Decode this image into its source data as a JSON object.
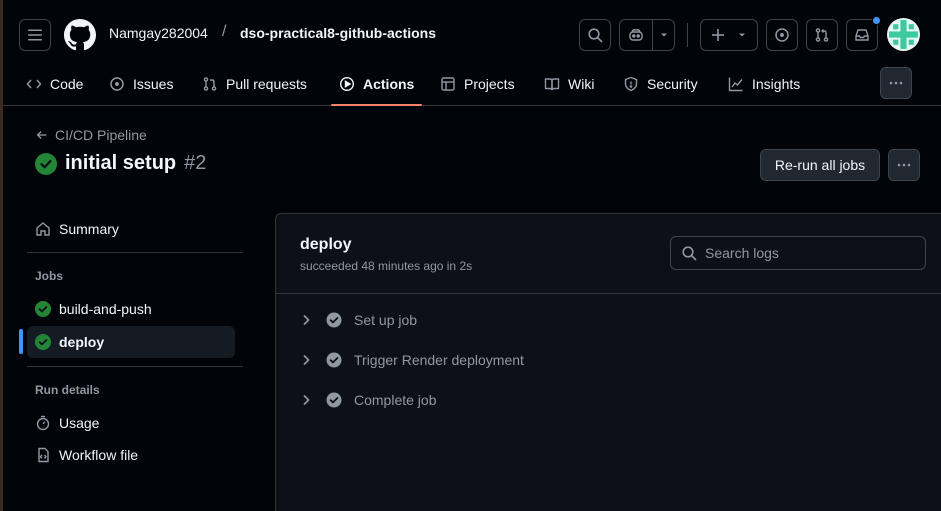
{
  "header": {
    "owner": "Namgay282004",
    "separator": "/",
    "repo": "dso-practical8-github-actions",
    "icons": [
      "menu-icon",
      "github-logo",
      "search-icon",
      "copilot-icon",
      "chevron-down-icon",
      "plus-icon",
      "issues-icon",
      "pull-request-icon",
      "inbox-icon",
      "avatar"
    ],
    "notification_dot_color": "#4493f8"
  },
  "nav": {
    "items": [
      {
        "label": "Code",
        "icon": "code-icon"
      },
      {
        "label": "Issues",
        "icon": "issue-icon"
      },
      {
        "label": "Pull requests",
        "icon": "pull-request-icon"
      },
      {
        "label": "Actions",
        "icon": "play-icon",
        "active": true
      },
      {
        "label": "Projects",
        "icon": "table-icon"
      },
      {
        "label": "Wiki",
        "icon": "book-icon"
      },
      {
        "label": "Security",
        "icon": "shield-icon"
      },
      {
        "label": "Insights",
        "icon": "graph-icon"
      }
    ],
    "active_underline_color": "#f78166"
  },
  "run": {
    "back_label": "CI/CD Pipeline",
    "title": "initial setup",
    "number": "#2",
    "status_color": "#238636",
    "rerun_label": "Re-run all jobs"
  },
  "sidebar": {
    "summary_label": "Summary",
    "jobs_heading": "Jobs",
    "jobs": [
      {
        "label": "build-and-push",
        "status": "success"
      },
      {
        "label": "deploy",
        "status": "success",
        "selected": true
      }
    ],
    "run_details_heading": "Run details",
    "usage_label": "Usage",
    "workflow_file_label": "Workflow file"
  },
  "job": {
    "name": "deploy",
    "status_text": "succeeded 48 minutes ago in 2s",
    "search_placeholder": "Search logs",
    "steps": [
      {
        "label": "Set up job"
      },
      {
        "label": "Trigger Render deployment"
      },
      {
        "label": "Complete job"
      }
    ]
  }
}
